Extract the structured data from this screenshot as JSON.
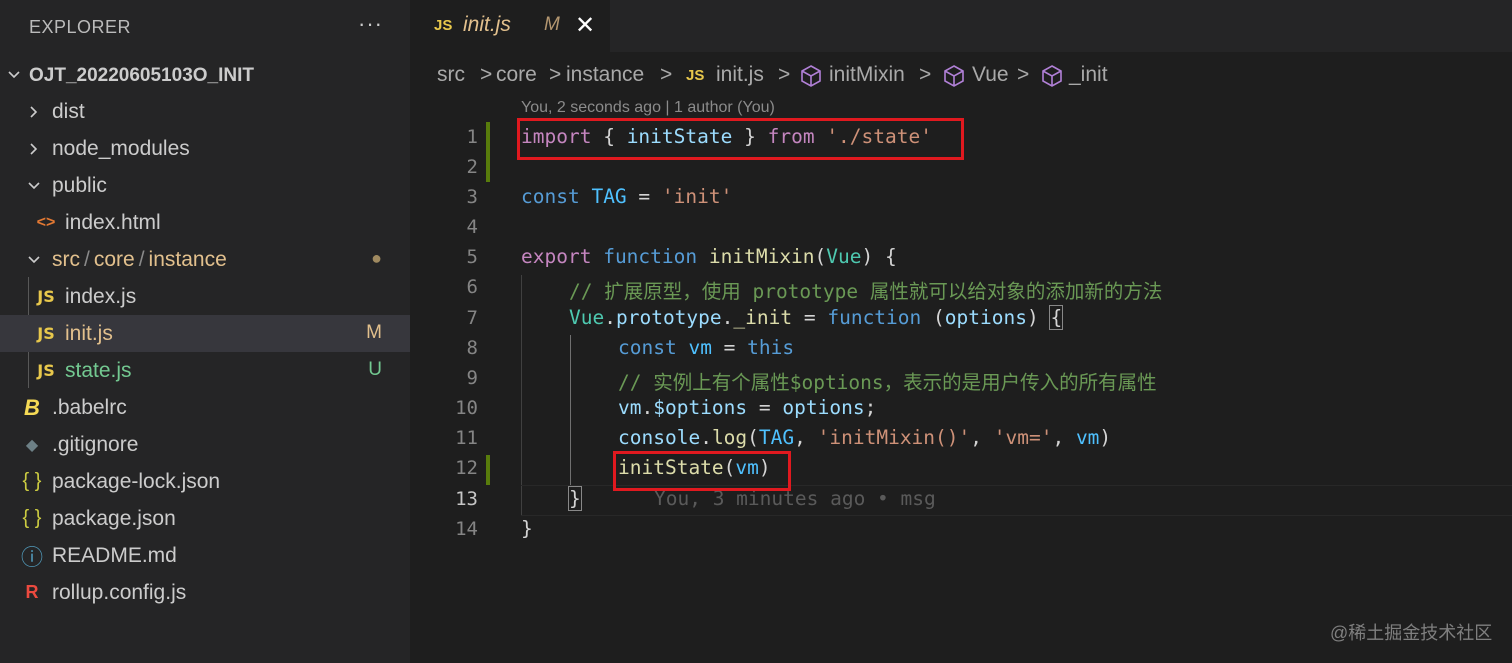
{
  "explorer": {
    "title": "EXPLORER",
    "more": "···",
    "root": "OJT_20220605103O_INIT",
    "items": [
      {
        "label": "dist",
        "kind": "folder",
        "expanded": false
      },
      {
        "label": "node_modules",
        "kind": "folder",
        "expanded": false
      },
      {
        "label": "public",
        "kind": "folder",
        "expanded": true
      },
      {
        "label": "index.html",
        "kind": "html"
      },
      {
        "label_parts": [
          "src",
          "/",
          "core",
          "/",
          "instance"
        ],
        "kind": "folder",
        "expanded": true,
        "badge": "●"
      },
      {
        "label": "index.js",
        "kind": "js"
      },
      {
        "label": "init.js",
        "kind": "js",
        "badge": "M",
        "selected": true
      },
      {
        "label": "state.js",
        "kind": "js",
        "badge": "U"
      },
      {
        "label": ".babelrc",
        "kind": "babel"
      },
      {
        "label": ".gitignore",
        "kind": "git"
      },
      {
        "label": "package-lock.json",
        "kind": "json"
      },
      {
        "label": "package.json",
        "kind": "json"
      },
      {
        "label": "README.md",
        "kind": "info"
      },
      {
        "label": "rollup.config.js",
        "kind": "rollup"
      }
    ],
    "icon_text": {
      "js": "JS",
      "json": "{ }",
      "html": "<>",
      "info": "ⓘ",
      "babel": "B",
      "git": "◆",
      "rollup": "R"
    }
  },
  "tab": {
    "js": "JS",
    "name": "init.js",
    "status": "M",
    "close": "✕"
  },
  "breadcrumb": {
    "parts": [
      "src",
      "core",
      "instance",
      "init.js",
      "initMixin",
      "Vue",
      "_init"
    ],
    "sep": ">",
    "js": "JS"
  },
  "blame_header": "You, 2 seconds ago | 1 author (You)",
  "inline_blame": "You, 3 minutes ago • msg",
  "line_numbers": [
    "1",
    "2",
    "3",
    "4",
    "5",
    "6",
    "7",
    "8",
    "9",
    "10",
    "11",
    "12",
    "13",
    "14"
  ],
  "code": {
    "l1": {
      "import": "import",
      "open": " { ",
      "name": "initState",
      "close": " } ",
      "from": "from",
      "sp": " ",
      "path": "'./state'"
    },
    "l3": {
      "const": "const",
      "sp": " ",
      "tag": "TAG",
      "eq": " = ",
      "val": "'init'"
    },
    "l5": {
      "export": "export",
      "sp1": " ",
      "function": "function",
      "sp2": " ",
      "name": "initMixin",
      "open": "(",
      "param": "Vue",
      "close": ") {"
    },
    "l6": {
      "comment": "// 扩展原型，使用 prototype 属性就可以给对象的添加新的方法"
    },
    "l7": {
      "vue": "Vue",
      "dot1": ".",
      "proto": "prototype",
      "dot2": ".",
      "init": "_init",
      "eq": " = ",
      "function": "function",
      "sp": " ",
      "open": "(",
      "param": "options",
      "close": ") ",
      "brace": "{"
    },
    "l8": {
      "const": "const",
      "sp": " ",
      "vm": "vm",
      "eq": " = ",
      "this": "this"
    },
    "l9": {
      "comment": "// 实例上有个属性$options，表示的是用户传入的所有属性"
    },
    "l10": {
      "vm": "vm",
      "dot": ".",
      "prop": "$options",
      "eq": " = ",
      "val": "options",
      "semi": ";"
    },
    "l11": {
      "console": "console",
      "dot": ".",
      "log": "log",
      "open": "(",
      "tag": "TAG",
      "c1": ", ",
      "s1": "'initMixin()'",
      "c2": ", ",
      "s2": "'vm='",
      "c3": ", ",
      "vm": "vm",
      "close": ")"
    },
    "l12": {
      "fn": "initState",
      "open": "(",
      "arg": "vm",
      "close": ")"
    },
    "l13": {
      "brace": "}"
    },
    "l14": {
      "brace": "}"
    }
  },
  "watermark": "@稀土掘金技术社区"
}
